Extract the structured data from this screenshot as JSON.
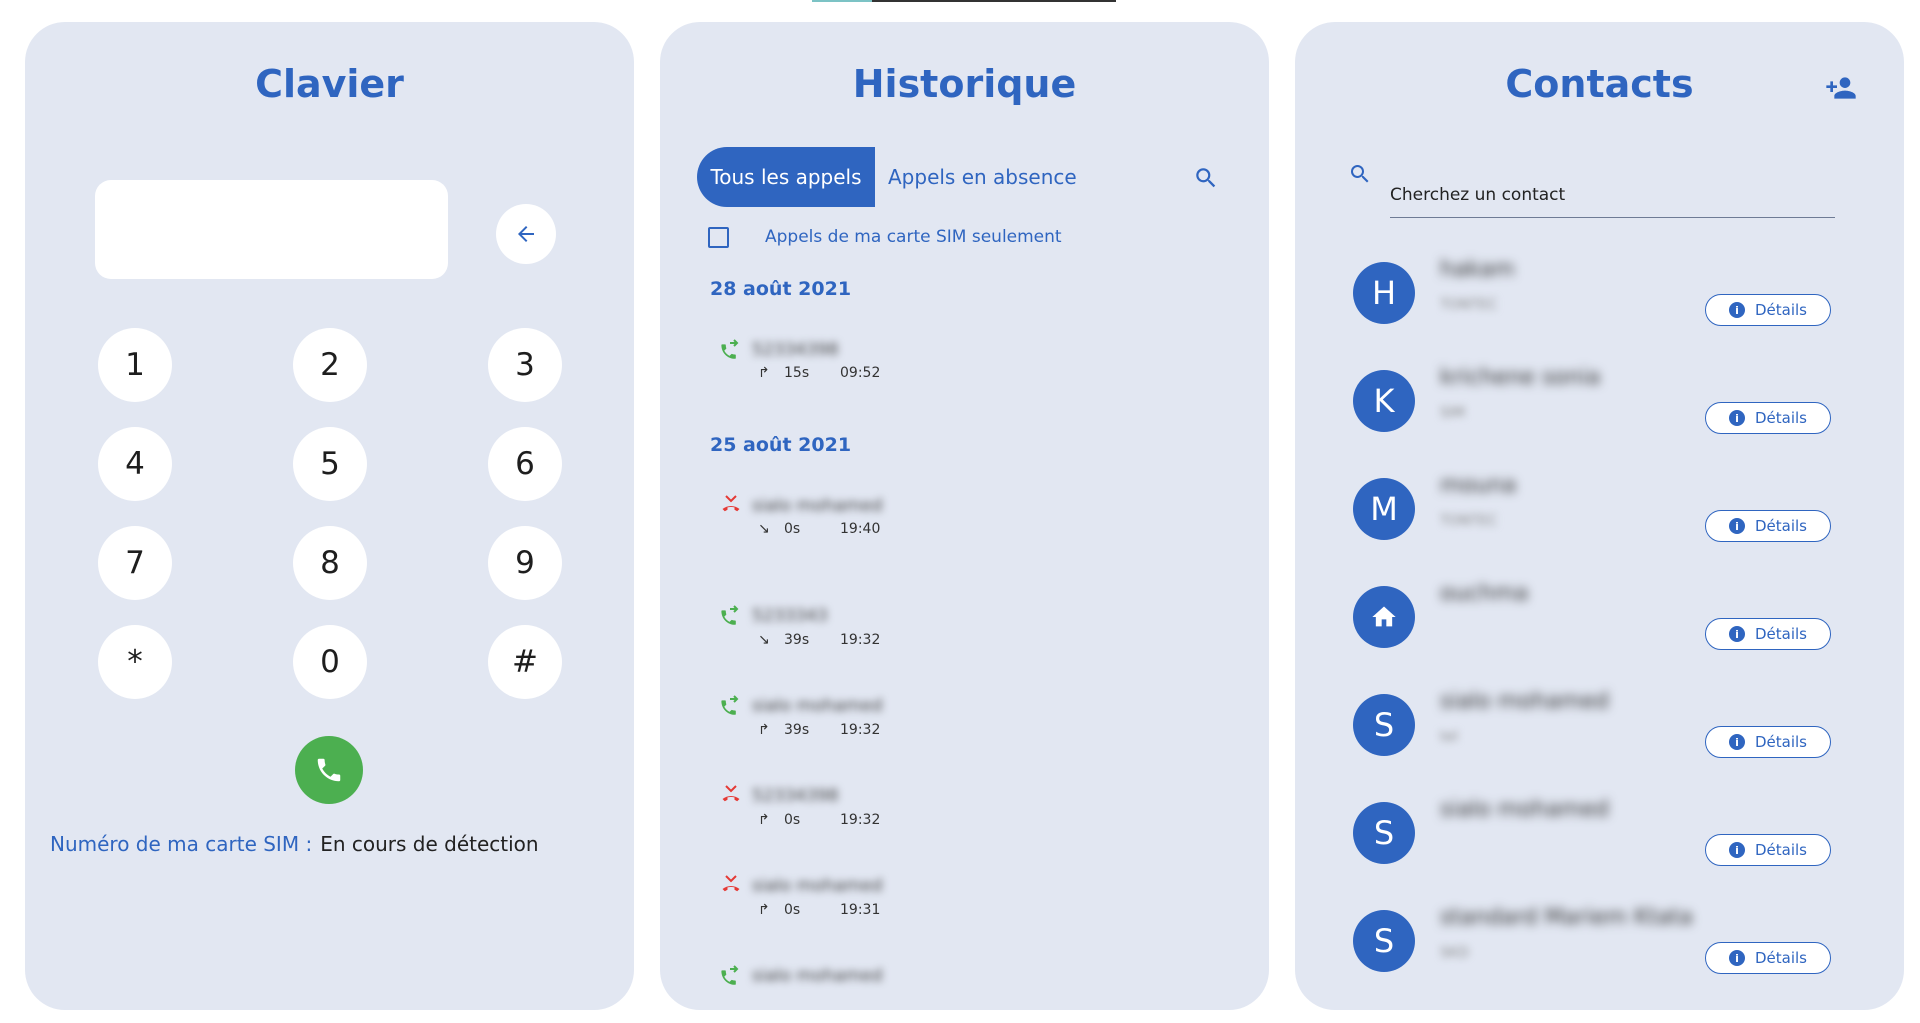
{
  "colors": {
    "accent": "#2f65c0",
    "panel": "#e2e7f2",
    "call_green": "#4caf50",
    "missed_red": "#e53935"
  },
  "dialer": {
    "title": "Clavier",
    "display_value": "",
    "keys": [
      "1",
      "2",
      "3",
      "4",
      "5",
      "6",
      "7",
      "8",
      "9",
      "*",
      "0",
      "#"
    ],
    "sim_label": "Numéro de ma carte SIM :",
    "sim_value": "En cours de détection"
  },
  "history": {
    "title": "Historique",
    "tab_all": "Tous les appels",
    "tab_missed": "Appels en absence",
    "sim_only_label": "Appels de ma carte SIM seulement",
    "sim_only_checked": false,
    "groups": [
      {
        "date": "28 août 2021",
        "calls": [
          {
            "type": "outgoing",
            "name": "52334398",
            "dir_icon": "in-arrow",
            "duration": "15s",
            "time": "09:52"
          }
        ]
      },
      {
        "date": "25 août 2021",
        "calls": [
          {
            "type": "missed",
            "name": "sialo mohamed",
            "dir_icon": "out-arrow",
            "duration": "0s",
            "time": "19:40"
          },
          {
            "type": "outgoing",
            "name": "5233343",
            "dir_icon": "out-arrow",
            "duration": "39s",
            "time": "19:32"
          },
          {
            "type": "outgoing",
            "name": "sialo mohamed",
            "dir_icon": "in-arrow",
            "duration": "39s",
            "time": "19:32"
          },
          {
            "type": "missed",
            "name": "52334398",
            "dir_icon": "in-arrow",
            "duration": "0s",
            "time": "19:32"
          },
          {
            "type": "missed",
            "name": "sialo mohamed",
            "dir_icon": "in-arrow",
            "duration": "0s",
            "time": "19:31"
          },
          {
            "type": "outgoing",
            "name": "sialo mohamed",
            "dir_icon": "",
            "duration": "",
            "time": ""
          }
        ]
      }
    ]
  },
  "contacts": {
    "title": "Contacts",
    "search_placeholder": "Cherchez un contact",
    "details_label": "Détails",
    "items": [
      {
        "initial": "H",
        "name": "hakam",
        "sub": "TONTEC"
      },
      {
        "initial": "K",
        "name": "krichene sonia",
        "sub": "SIM"
      },
      {
        "initial": "M",
        "name": "mouna",
        "sub": "TONTEC"
      },
      {
        "initial": "",
        "icon": "home-icon",
        "name": "ouchma",
        "sub": ""
      },
      {
        "initial": "S",
        "name": "sialo mohamed",
        "sub": "tel"
      },
      {
        "initial": "S",
        "name": "sialo mohamed",
        "sub": ""
      },
      {
        "initial": "S",
        "name": "standard Mariem Ktata",
        "sub": "SKD"
      }
    ]
  }
}
